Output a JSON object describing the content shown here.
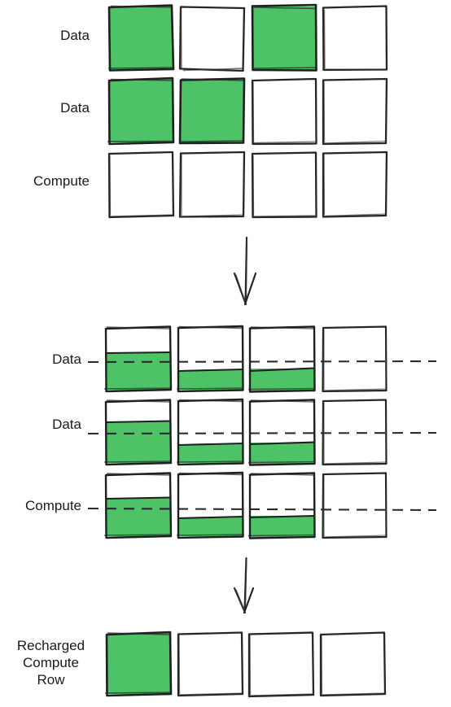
{
  "diagram": {
    "title_present": false,
    "colors": {
      "fill_green": "#4EC266",
      "stroke_dark": "#1f1f1f",
      "background": "#ffffff",
      "dashed_line": "#2b2b2b"
    },
    "sections": [
      {
        "id": "section-initial-grid",
        "name": "initial-grid",
        "rows": [
          {
            "label": "Data",
            "cells": [
              {
                "fill_ratio": 1.0,
                "filled": true
              },
              {
                "fill_ratio": 0.0,
                "filled": false
              },
              {
                "fill_ratio": 1.0,
                "filled": true
              },
              {
                "fill_ratio": 0.0,
                "filled": false
              }
            ]
          },
          {
            "label": "Data",
            "cells": [
              {
                "fill_ratio": 1.0,
                "filled": true
              },
              {
                "fill_ratio": 1.0,
                "filled": true
              },
              {
                "fill_ratio": 0.0,
                "filled": false
              },
              {
                "fill_ratio": 0.0,
                "filled": false
              }
            ]
          },
          {
            "label": "Compute",
            "cells": [
              {
                "fill_ratio": 0.0,
                "filled": false
              },
              {
                "fill_ratio": 0.0,
                "filled": false
              },
              {
                "fill_ratio": 0.0,
                "filled": false
              },
              {
                "fill_ratio": 0.0,
                "filled": false
              }
            ]
          }
        ]
      },
      {
        "id": "section-partial-grid",
        "name": "partial-fill-grid",
        "has_threshold_lines": true,
        "rows": [
          {
            "label": "Data",
            "threshold_ratio": 0.55,
            "cells": [
              {
                "fill_ratio": 0.6,
                "filled": true
              },
              {
                "fill_ratio": 0.32,
                "filled": true
              },
              {
                "fill_ratio": 0.33,
                "filled": true
              },
              {
                "fill_ratio": 0.0,
                "filled": false
              }
            ]
          },
          {
            "label": "Data",
            "threshold_ratio": 0.45,
            "cells": [
              {
                "fill_ratio": 0.68,
                "filled": true
              },
              {
                "fill_ratio": 0.3,
                "filled": true
              },
              {
                "fill_ratio": 0.32,
                "filled": true
              },
              {
                "fill_ratio": 0.0,
                "filled": false
              }
            ]
          },
          {
            "label": "Compute",
            "threshold_ratio": 0.5,
            "cells": [
              {
                "fill_ratio": 0.64,
                "filled": true
              },
              {
                "fill_ratio": 0.3,
                "filled": true
              },
              {
                "fill_ratio": 0.32,
                "filled": true
              },
              {
                "fill_ratio": 0.0,
                "filled": false
              }
            ]
          }
        ]
      },
      {
        "id": "section-result-row",
        "name": "recharged-compute-row",
        "rows": [
          {
            "label": "Recharged\nCompute\nRow",
            "label_lines": [
              "Recharged",
              "Compute",
              "Row"
            ],
            "cells": [
              {
                "fill_ratio": 1.0,
                "filled": true
              },
              {
                "fill_ratio": 0.0,
                "filled": false
              },
              {
                "fill_ratio": 0.0,
                "filled": false
              },
              {
                "fill_ratio": 0.0,
                "filled": false
              }
            ]
          }
        ]
      }
    ],
    "arrows": [
      {
        "id": "arrow-top-to-middle",
        "direction": "down"
      },
      {
        "id": "arrow-middle-to-bottom",
        "direction": "down"
      }
    ],
    "labels": {
      "row1_top": "Data",
      "row2_top": "Data",
      "row3_top": "Compute",
      "row1_mid": "Data",
      "row2_mid": "Data",
      "row3_mid": "Compute",
      "result_line1": "Recharged",
      "result_line2": "Compute",
      "result_line3": "Row"
    }
  }
}
